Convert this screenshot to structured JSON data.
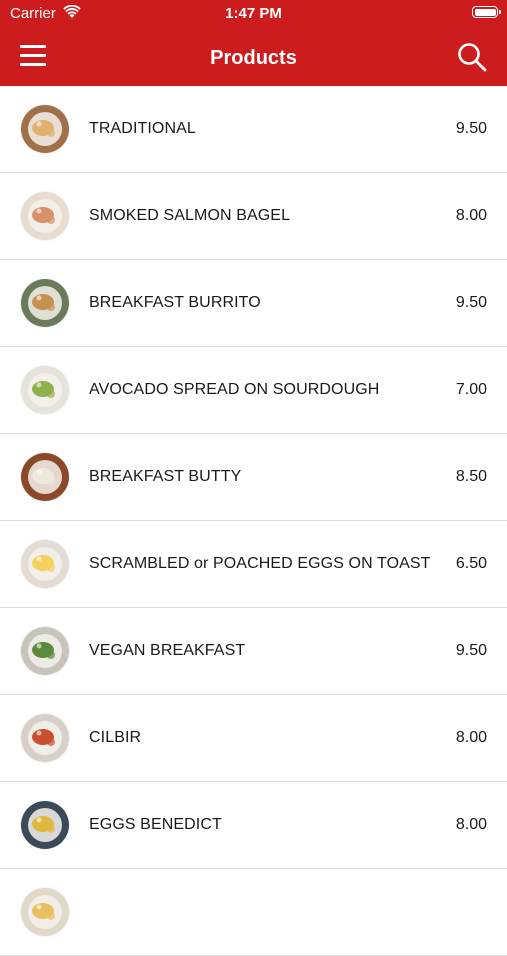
{
  "status": {
    "carrier": "Carrier",
    "time": "1:47 PM"
  },
  "nav": {
    "title": "Products"
  },
  "products": [
    {
      "name": "TRADITIONAL",
      "price": "9.50",
      "plate": "#a0704a",
      "food": "#e0b070"
    },
    {
      "name": "SMOKED SALMON BAGEL",
      "price": "8.00",
      "plate": "#e8dcd0",
      "food": "#d89068"
    },
    {
      "name": "BREAKFAST BURRITO",
      "price": "9.50",
      "plate": "#6b7a5a",
      "food": "#c89050"
    },
    {
      "name": "AVOCADO SPREAD ON SOURDOUGH",
      "price": "7.00",
      "plate": "#e6e3dc",
      "food": "#8fb04a"
    },
    {
      "name": "BREAKFAST BUTTY",
      "price": "8.50",
      "plate": "#8a4a2a",
      "food": "#f0e8dc"
    },
    {
      "name": "SCRAMBLED or POACHED EGGS ON TOAST",
      "price": "6.50",
      "plate": "#e4dcd4",
      "food": "#f3d060"
    },
    {
      "name": "VEGAN BREAKFAST",
      "price": "9.50",
      "plate": "#c8c4bc",
      "food": "#5a8a3a"
    },
    {
      "name": "CILBIR",
      "price": "8.00",
      "plate": "#d8d0c8",
      "food": "#c85030"
    },
    {
      "name": "EGGS BENEDICT",
      "price": "8.00",
      "plate": "#3a4a5a",
      "food": "#e0b840"
    },
    {
      "name": "",
      "price": "",
      "plate": "#e0d8c8",
      "food": "#e8c060"
    }
  ],
  "colors": {
    "accent": "#cc1c1d"
  }
}
